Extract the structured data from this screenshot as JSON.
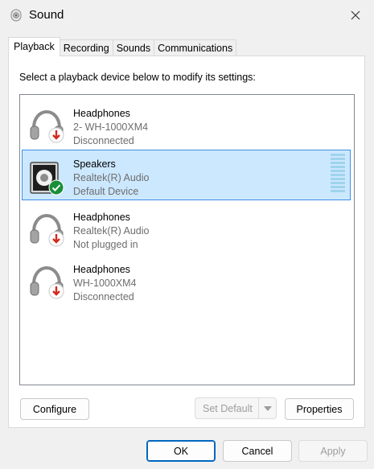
{
  "window": {
    "title": "Sound",
    "title_icon": "speaker-icon",
    "close_icon": "close-icon"
  },
  "tabs": [
    {
      "label": "Playback",
      "active": true
    },
    {
      "label": "Recording",
      "active": false
    },
    {
      "label": "Sounds",
      "active": false
    },
    {
      "label": "Communications",
      "active": false
    }
  ],
  "playback": {
    "instruction": "Select a playback device below to modify its settings:",
    "devices": [
      {
        "name": "Headphones",
        "line1": "2- WH-1000XM4",
        "line2": "Disconnected",
        "icon": "headphones-icon",
        "status_icon": "disconnected-arrow-icon",
        "selected": false
      },
      {
        "name": "Speakers",
        "line1": "Realtek(R) Audio",
        "line2": "Default Device",
        "icon": "speakers-icon",
        "status_icon": "default-check-icon",
        "selected": true
      },
      {
        "name": "Headphones",
        "line1": "Realtek(R) Audio",
        "line2": "Not plugged in",
        "icon": "headphones-icon",
        "status_icon": "disconnected-arrow-icon",
        "selected": false
      },
      {
        "name": "Headphones",
        "line1": "WH-1000XM4",
        "line2": "Disconnected",
        "icon": "headphones-icon",
        "status_icon": "disconnected-arrow-icon",
        "selected": false
      }
    ],
    "buttons": {
      "configure": "Configure",
      "set_default": "Set Default",
      "properties": "Properties"
    }
  },
  "dialog_buttons": {
    "ok": "OK",
    "cancel": "Cancel",
    "apply": "Apply"
  },
  "colors": {
    "selection_bg": "#cce8ff",
    "selection_border": "#3c8fe8",
    "accent": "#0067c0",
    "disconnected_red": "#d42a1e",
    "default_green": "#1a8f3a"
  }
}
